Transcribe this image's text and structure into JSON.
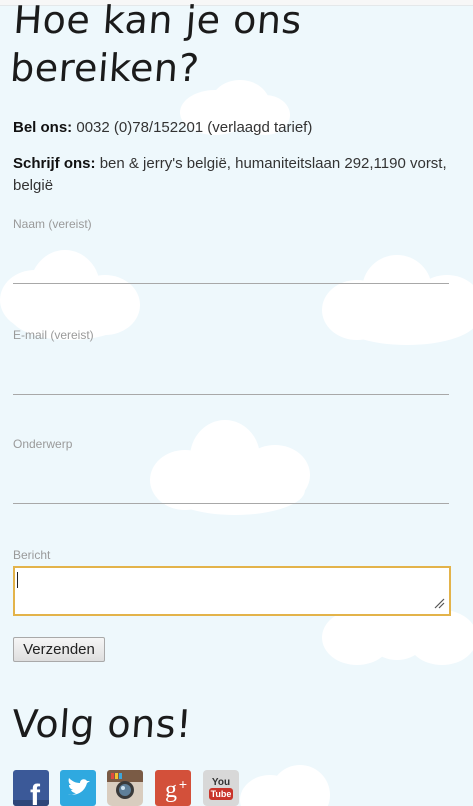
{
  "contact": {
    "title": "Hoe kan je ons bereiken?",
    "phone_label": "Bel ons:",
    "phone_value": "0032 (0)78/152201 (verlaagd tarief)",
    "write_label": "Schrijf ons:",
    "write_value": "ben & jerry's belgië, humaniteitslaan 292,1190 vorst, belgië"
  },
  "form": {
    "name_label": "Naam (vereist)",
    "name_value": "",
    "email_label": "E-mail (vereist)",
    "email_value": "",
    "subject_label": "Onderwerp",
    "subject_value": "",
    "message_label": "Bericht",
    "message_value": "",
    "submit_label": "Verzenden"
  },
  "follow": {
    "title": "Volg ons!",
    "icons": [
      {
        "name": "facebook-icon",
        "color": "#3b5998",
        "glyph": "f"
      },
      {
        "name": "twitter-icon",
        "color": "#2fa9e0",
        "glyph": "t"
      },
      {
        "name": "instagram-icon",
        "color": "#7a5b45",
        "glyph": "cam"
      },
      {
        "name": "google-plus-icon",
        "color": "#d3503a",
        "glyph": "g+"
      },
      {
        "name": "youtube-icon",
        "color": "#c9342a",
        "glyph": "You Tube"
      }
    ]
  },
  "colors": {
    "background": "#eef8fc",
    "focus_border": "#e3b34a",
    "underline": "#a8a8a8"
  }
}
